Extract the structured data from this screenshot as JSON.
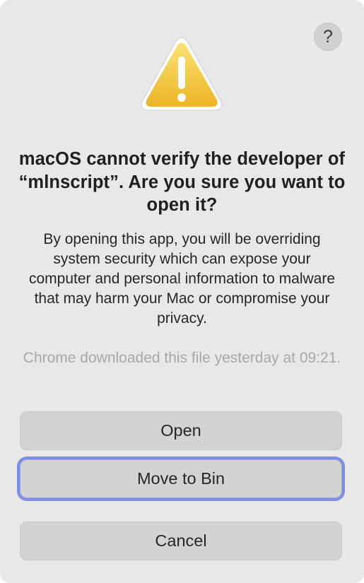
{
  "dialog": {
    "help_label": "?",
    "icon": "warning-triangle-icon",
    "title": "macOS cannot verify the developer of “mlnscript”. Are you sure you want to open it?",
    "body": "By opening this app, you will be overriding system security which can expose your computer and personal information to malware that may harm your Mac or compromise your privacy.",
    "download_note": "Chrome downloaded this file yesterday at 09:21.",
    "buttons": {
      "open": "Open",
      "move_to_bin": "Move to Bin",
      "cancel": "Cancel"
    },
    "colors": {
      "background": "#e8e8e8",
      "button": "#d3d3d3",
      "focus_ring": "#7f8fe0",
      "warning_yellow": "#f2c230"
    }
  }
}
